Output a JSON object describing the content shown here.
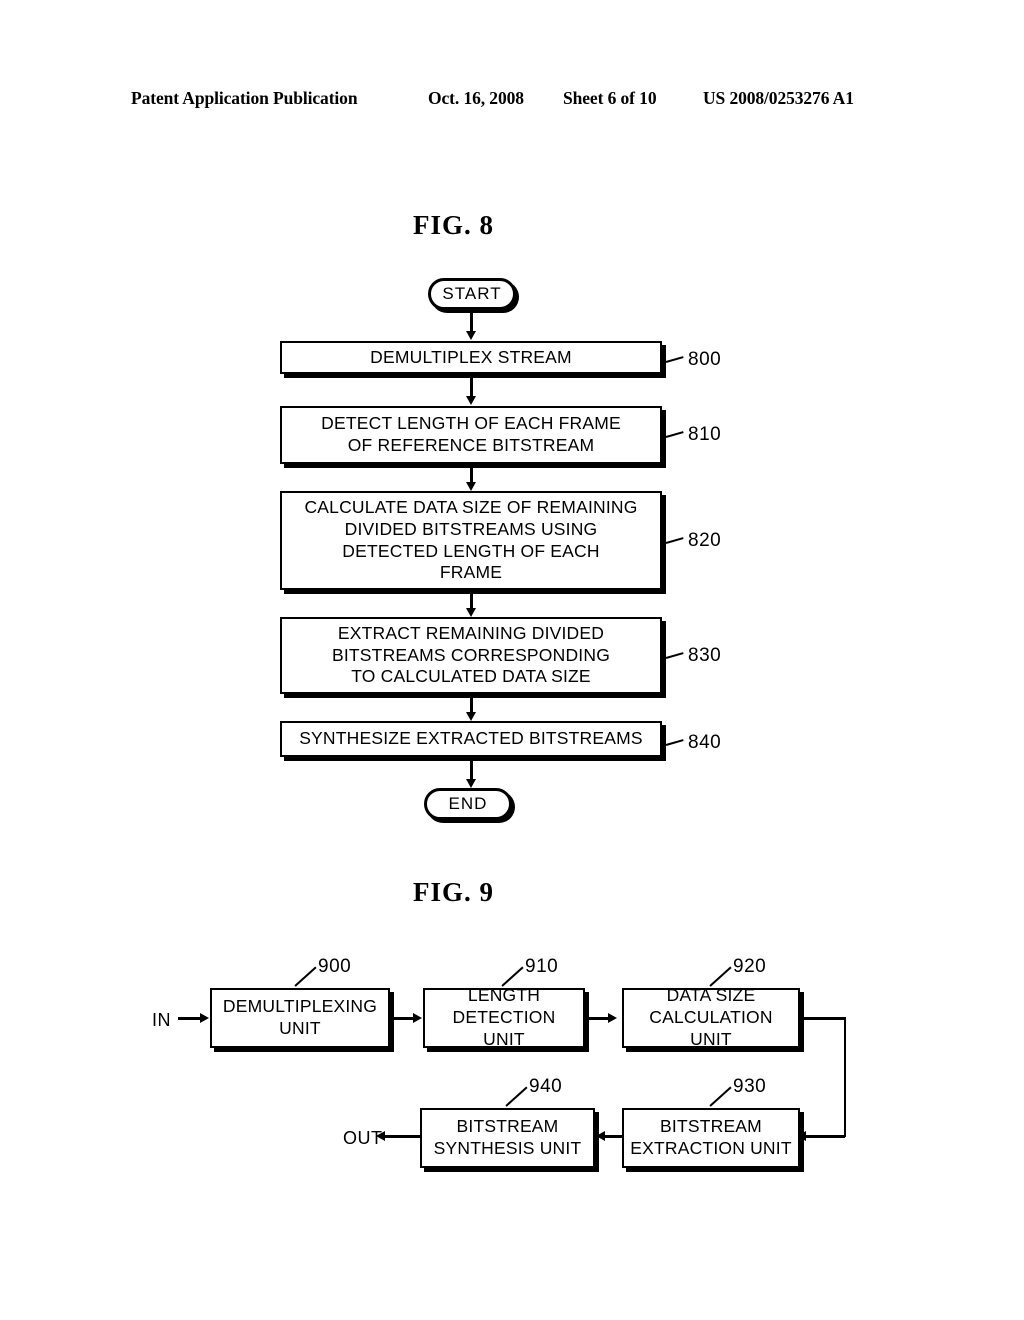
{
  "header": {
    "publication": "Patent Application Publication",
    "date": "Oct. 16, 2008",
    "sheet": "Sheet 6 of 10",
    "patent_number": "US 2008/0253276 A1"
  },
  "figures": [
    {
      "caption": "FIG.  8",
      "type": "flowchart",
      "nodes": [
        {
          "id": "start",
          "shape": "terminator",
          "label": "START",
          "ref": null
        },
        {
          "id": "s800",
          "shape": "process",
          "label": "DEMULTIPLEX STREAM",
          "ref": "800"
        },
        {
          "id": "s810",
          "shape": "process",
          "label": "DETECT LENGTH OF EACH FRAME\nOF REFERENCE BITSTREAM",
          "ref": "810"
        },
        {
          "id": "s820",
          "shape": "process",
          "label": "CALCULATE DATA SIZE OF REMAINING\nDIVIDED BITSTREAMS USING\nDETECTED LENGTH OF EACH\nFRAME",
          "ref": "820"
        },
        {
          "id": "s830",
          "shape": "process",
          "label": "EXTRACT REMAINING DIVIDED\nBITSTREAMS CORRESPONDING\nTO CALCULATED DATA SIZE",
          "ref": "830"
        },
        {
          "id": "s840",
          "shape": "process",
          "label": "SYNTHESIZE EXTRACTED BITSTREAMS",
          "ref": "840"
        },
        {
          "id": "end",
          "shape": "terminator",
          "label": "END",
          "ref": null
        }
      ]
    },
    {
      "caption": "FIG.  9",
      "type": "block-diagram",
      "io": {
        "input": "IN",
        "output": "OUT"
      },
      "blocks": [
        {
          "id": "b900",
          "label": "DEMULTIPLEXING\nUNIT",
          "ref": "900"
        },
        {
          "id": "b910",
          "label": "LENGTH\nDETECTION UNIT",
          "ref": "910"
        },
        {
          "id": "b920",
          "label": "DATA SIZE\nCALCULATION UNIT",
          "ref": "920"
        },
        {
          "id": "b930",
          "label": "BITSTREAM\nEXTRACTION UNIT",
          "ref": "930"
        },
        {
          "id": "b940",
          "label": "BITSTREAM\nSYNTHESIS UNIT",
          "ref": "940"
        }
      ]
    }
  ]
}
